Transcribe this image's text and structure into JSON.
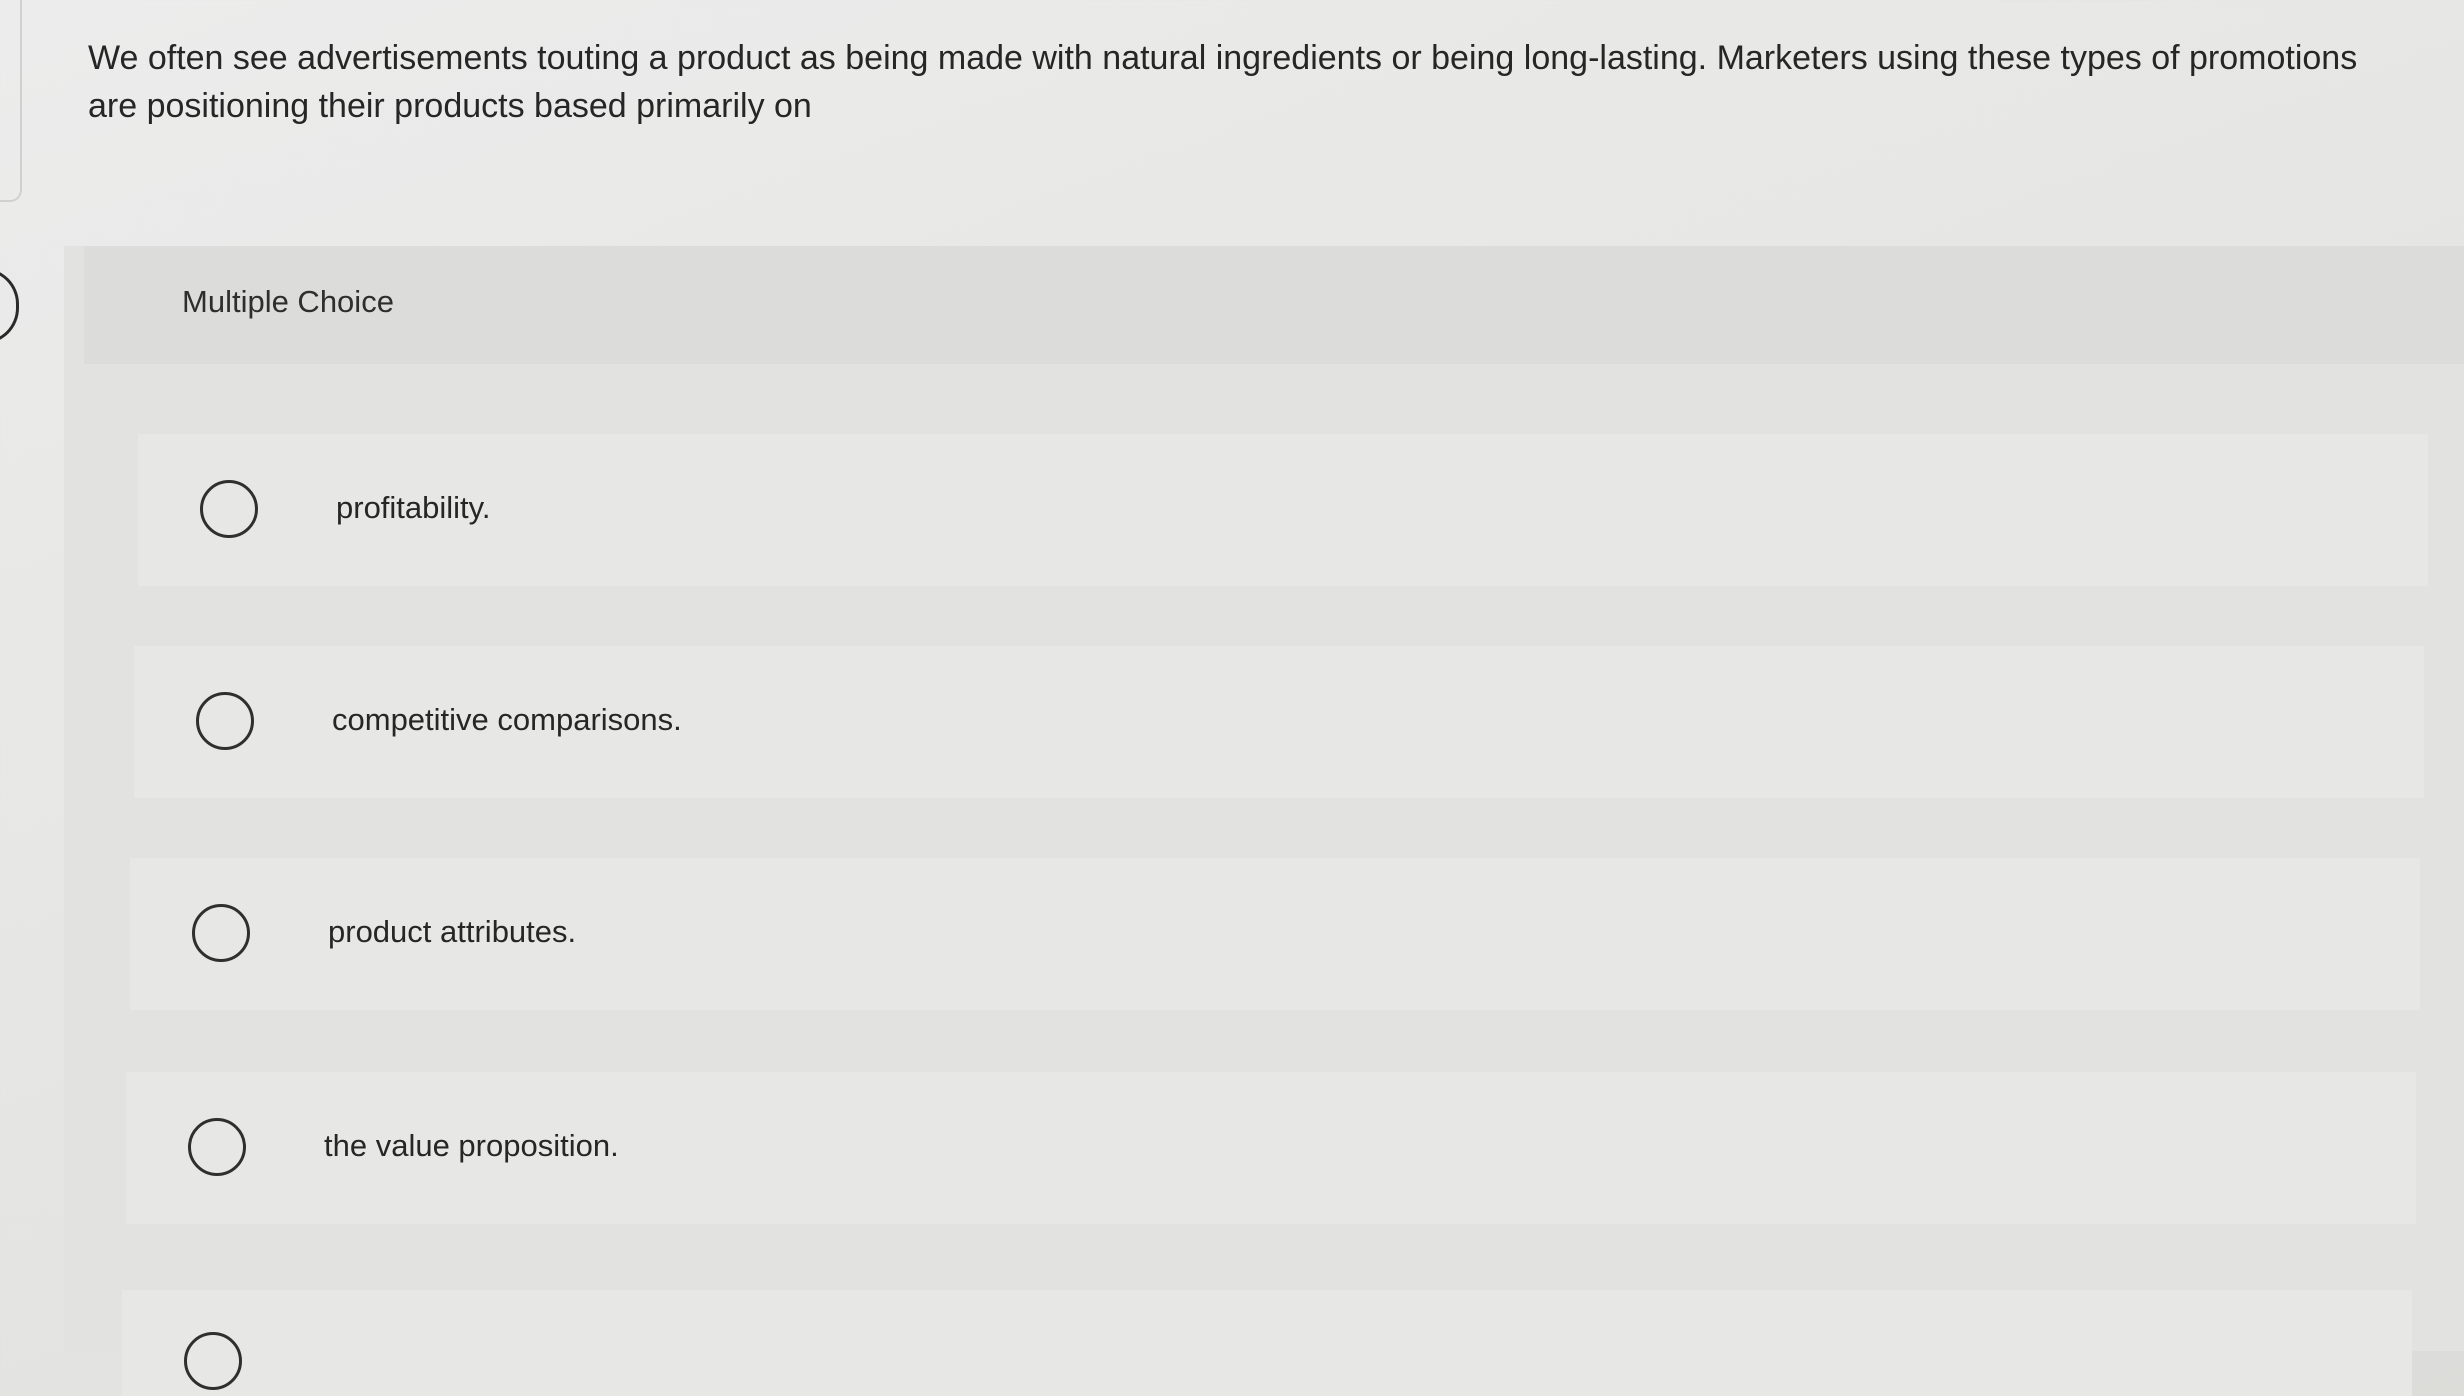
{
  "question": {
    "text": "We often see advertisements touting a product as being made with natural ingredients or being long-lasting. Marketers using these types of promotions are positioning their products based primarily on"
  },
  "question_panel": {
    "label": "Multiple Choice"
  },
  "choices": [
    {
      "label": "profitability.",
      "selected": false
    },
    {
      "label": "competitive comparisons.",
      "selected": false
    },
    {
      "label": "product attributes.",
      "selected": false
    },
    {
      "label": "the value proposition.",
      "selected": false
    },
    {
      "label": "",
      "selected": false
    }
  ],
  "colors": {
    "background": "#e6e6e4",
    "panel": "#e2e2e0",
    "option_row": "#e7e7e5",
    "text": "#262626",
    "radio_border": "#2f2f2f"
  },
  "icons": {
    "radio": "radio-unchecked-icon",
    "nav": "side-nav-tab-icon"
  }
}
